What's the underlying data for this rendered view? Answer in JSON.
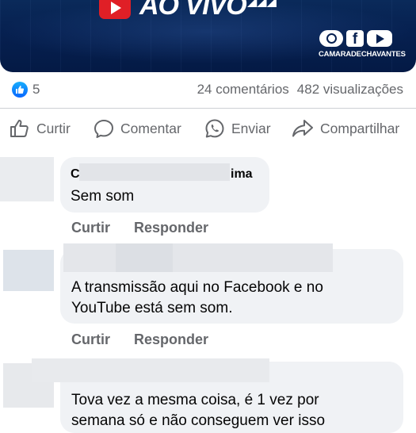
{
  "video": {
    "live_label": "AO VIVO",
    "channel_handle": "CAMARADECHAVANTES",
    "social_icons": [
      "instagram-icon",
      "facebook-icon",
      "youtube-icon"
    ],
    "fb_letter": "f"
  },
  "stats": {
    "reaction_count": "5",
    "comments": "24 comentários",
    "views": "482 visualizações"
  },
  "actions": {
    "like": "Curtir",
    "comment": "Comentar",
    "send": "Enviar",
    "share": "Compartilhar"
  },
  "comments": [
    {
      "author_start": "C",
      "author_end": "ima",
      "text": "Sem som",
      "like_label": "Curtir",
      "reply_label": "Responder"
    },
    {
      "text_line1": "A transmissão aqui no Facebook e no",
      "text_line2": "YouTube está sem som.",
      "like_label": "Curtir",
      "reply_label": "Responder"
    },
    {
      "text_line1": "Tova vez a mesma coisa, é 1 vez por",
      "text_line2": "semana só e não conseguem ver isso"
    }
  ],
  "colors": {
    "banner": "#062050",
    "youtube_red": "#e01f26",
    "like_blue": "#0866ff",
    "secondary_text": "#65676b",
    "bubble": "#f0f2f5"
  }
}
